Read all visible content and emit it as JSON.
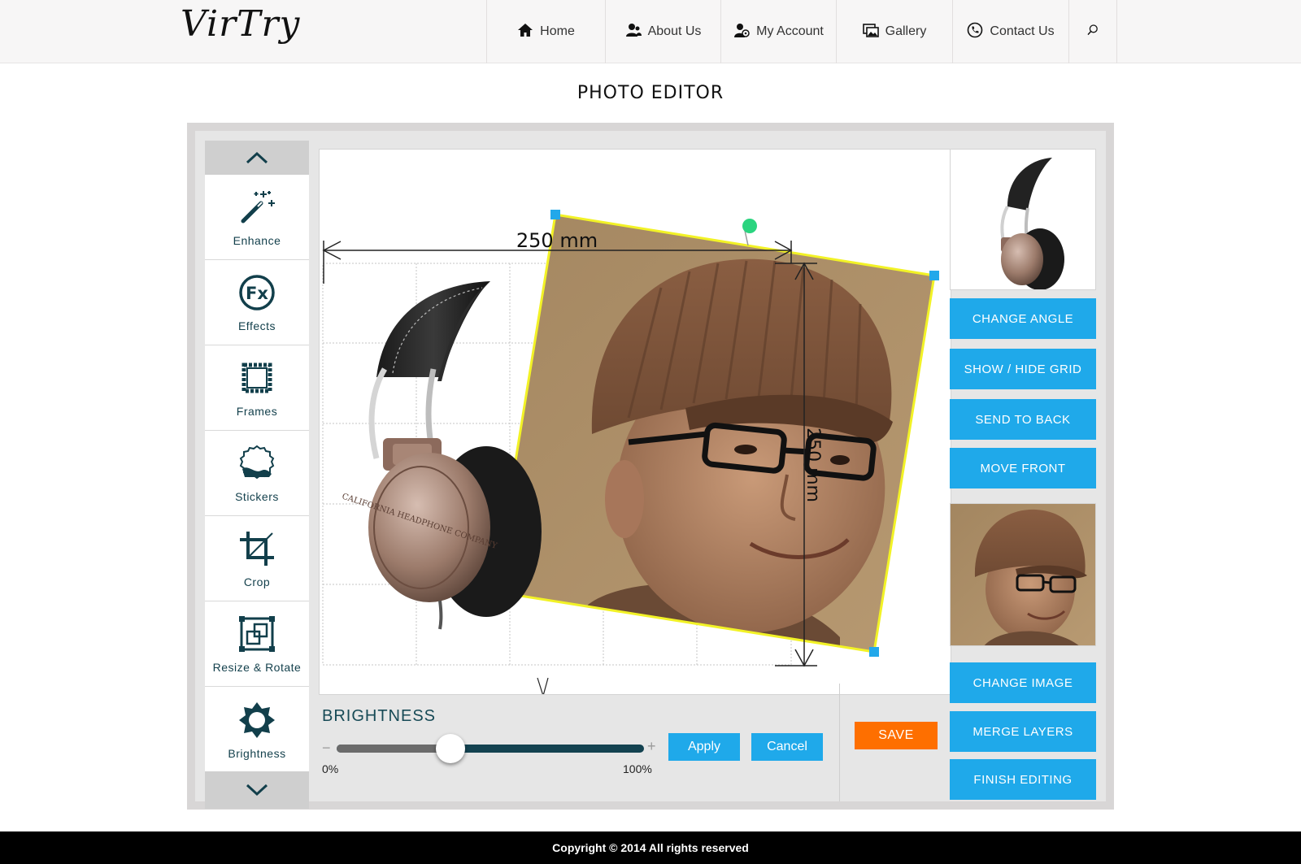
{
  "header": {
    "logo": "VirTry",
    "nav": [
      {
        "label": "Home",
        "icon": "home-icon"
      },
      {
        "label": "About Us",
        "icon": "users-icon"
      },
      {
        "label": "My Account",
        "icon": "account-icon"
      },
      {
        "label": "Gallery",
        "icon": "gallery-icon"
      },
      {
        "label": "Contact Us",
        "icon": "phone-icon"
      }
    ],
    "search_icon": "search-icon"
  },
  "page_title": "PHOTO EDITOR",
  "toolbar": {
    "items": [
      {
        "label": "Enhance",
        "icon": "magic-wand-icon"
      },
      {
        "label": "Effects",
        "icon": "fx-icon"
      },
      {
        "label": "Frames",
        "icon": "frame-icon"
      },
      {
        "label": "Stickers",
        "icon": "sticker-icon"
      },
      {
        "label": "Crop",
        "icon": "crop-icon"
      },
      {
        "label": "Resize & Rotate",
        "icon": "resize-rotate-icon"
      },
      {
        "label": "Brightness",
        "icon": "brightness-icon"
      }
    ]
  },
  "canvas": {
    "width_label": "250 mm",
    "height_label": "250 mm",
    "headphone_brand": "CALIFORNIA HEADPHONE COMPANY"
  },
  "brightness": {
    "title": "BRIGHTNESS",
    "value": 0.37,
    "min_label": "0%",
    "max_label": "100%",
    "minus": "−",
    "plus": "+",
    "apply": "Apply",
    "cancel": "Cancel"
  },
  "save": "SAVE",
  "right_panel": {
    "buttons_top": [
      "CHANGE ANGLE",
      "SHOW / HIDE GRID",
      "SEND TO BACK",
      "MOVE FRONT"
    ],
    "buttons_bottom": [
      "CHANGE IMAGE",
      "MERGE LAYERS",
      "FINISH EDITING"
    ]
  },
  "footer": "Copyright © 2014 All rights reserved",
  "colors": {
    "accent_blue": "#1fa9ea",
    "save_orange": "#fe6f00",
    "icon_teal": "#123f4b",
    "handle_blue": "#22a8ea",
    "rotate_handle": "#2bd47f"
  }
}
